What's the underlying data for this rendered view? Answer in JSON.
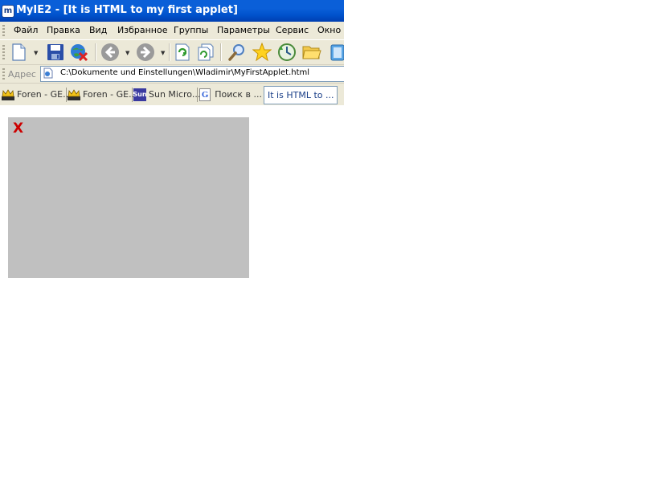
{
  "window": {
    "title": "MyIE2 - [It is HTML to my first applet]",
    "app_icon_glyph": "m"
  },
  "menu": {
    "items": [
      "Файл",
      "Правка",
      "Вид",
      "Избранное",
      "Группы",
      "Параметры",
      "Сервис",
      "Окно"
    ]
  },
  "toolbar": {
    "buttons": [
      {
        "icon": "new-page-icon"
      },
      {
        "icon": "save-icon"
      },
      {
        "icon": "disconnect-icon"
      },
      {
        "icon": "back-arrow-icon"
      },
      {
        "icon": "forward-arrow-icon"
      },
      {
        "icon": "refresh-icon"
      },
      {
        "icon": "refresh-all-icon"
      },
      {
        "icon": "search-icon"
      },
      {
        "icon": "favorites-star-icon"
      },
      {
        "icon": "history-icon"
      },
      {
        "icon": "open-folder-icon"
      },
      {
        "icon": "clipboard-icon"
      }
    ]
  },
  "address": {
    "label": "Адрес",
    "url": "C:\\Dokumente und Einstellungen\\Wladimir\\MyFirstApplet.html"
  },
  "tabs": [
    {
      "label": "Foren - GE...",
      "icon": "forum-crown-icon",
      "active": false
    },
    {
      "label": "Foren - GE...",
      "icon": "forum-crown-icon",
      "active": false
    },
    {
      "label": "Sun Micro...",
      "icon": "sun-logo-icon",
      "icon_text": "Sun",
      "active": false
    },
    {
      "label": "Поиск в ...",
      "icon": "google-g-icon",
      "icon_text": "G",
      "active": false
    },
    {
      "label": "It is HTML to ...",
      "icon": "",
      "active": true
    }
  ],
  "applet": {
    "error_glyph": "X"
  },
  "colors": {
    "titlebar": "#0052cc",
    "chrome": "#ece9d8",
    "applet_background": "#c0c0c0",
    "error_red": "#cc0000"
  }
}
